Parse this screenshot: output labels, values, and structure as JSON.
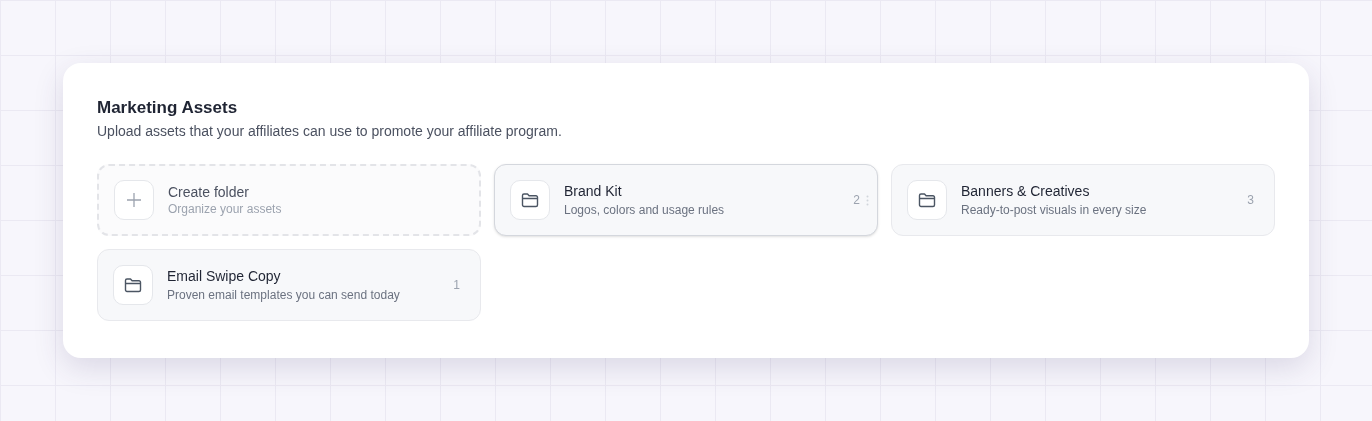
{
  "panel": {
    "title": "Marketing Assets",
    "subtitle": "Upload assets that your affiliates can use to promote your affiliate program."
  },
  "create_folder": {
    "title": "Create folder",
    "subtitle": "Organize your assets"
  },
  "folders": [
    {
      "name": "Brand Kit",
      "description": "Logos, colors and usage rules",
      "count": "2",
      "hovered": true
    },
    {
      "name": "Banners & Creatives",
      "description": "Ready-to-post visuals in every size",
      "count": "3",
      "hovered": false
    },
    {
      "name": "Email Swipe Copy",
      "description": "Proven email templates you can send today",
      "count": "1",
      "hovered": false
    }
  ]
}
